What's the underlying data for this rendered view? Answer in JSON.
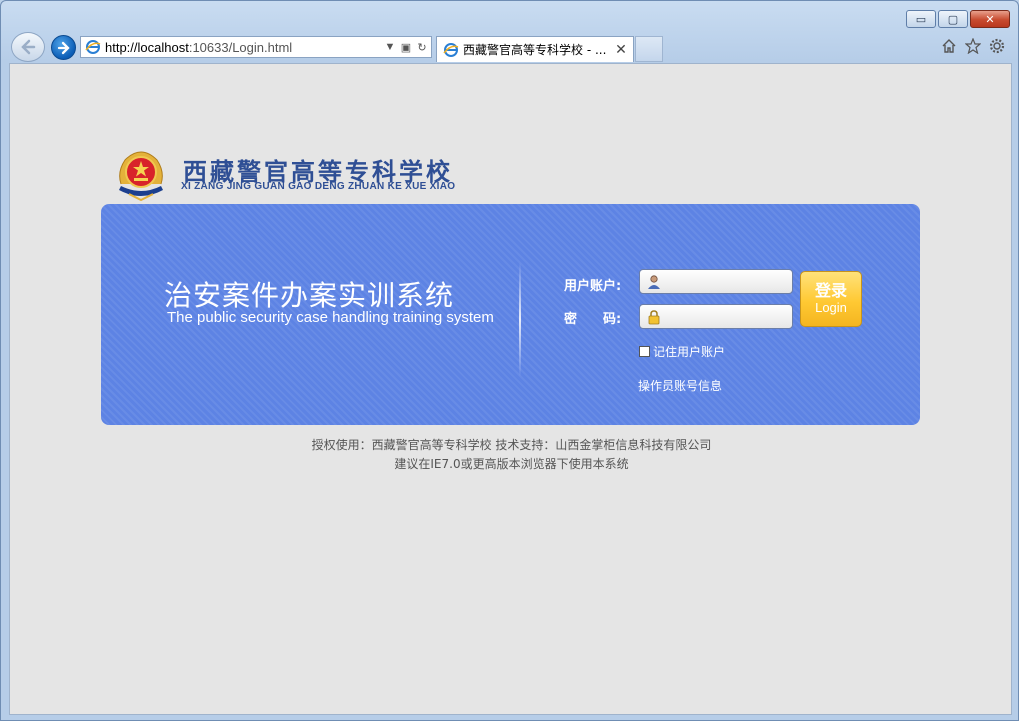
{
  "browser": {
    "url_host": "http://localhost",
    "url_rest": ":10633/Login.html",
    "tab_title": "西藏警官高等专科学校 - ...",
    "window_buttons": {
      "minimize": "▭",
      "restore": "▢",
      "close": "✕"
    }
  },
  "logo": {
    "name_cn": "西藏警官高等专科学校",
    "name_en": "XI ZANG JING GUAN GAO DENG ZHUAN KE XUE XIAO"
  },
  "login_panel": {
    "system_title": "治安案件办案实训系统",
    "system_subtitle": "The public security case handling training system",
    "username_label": "用户账户:",
    "password_label": "密　　码:",
    "username_value": "",
    "password_value": "",
    "login_button_cn": "登录",
    "login_button_en": "Login",
    "remember_label": "记住用户账户",
    "operator_link": "操作员账号信息"
  },
  "footer": {
    "line1": "授权使用：西藏警官高等专科学校 技术支持：山西金掌柜信息科技有限公司",
    "line2": "建议在IE7.0或更高版本浏览器下使用本系统"
  },
  "colors": {
    "panel": "#5d83e4",
    "button": "#ffc933",
    "page_bg": "#e5e5e5",
    "logo_text": "#2f4f95"
  }
}
